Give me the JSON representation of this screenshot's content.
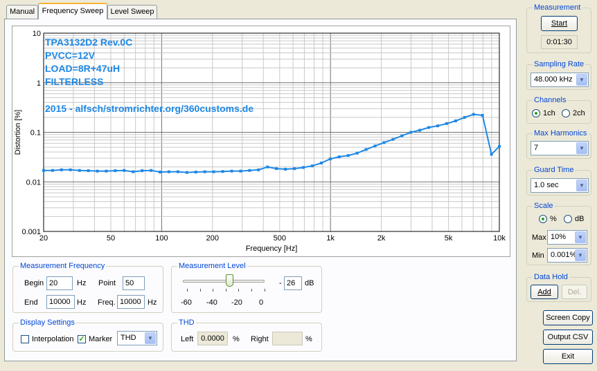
{
  "tabs": [
    {
      "label": "Manual"
    },
    {
      "label": "Frequency Sweep"
    },
    {
      "label": "Level Sweep"
    }
  ],
  "chart_data": {
    "type": "line",
    "ylabel": "Distortion [%]",
    "xlabel": "Frequency [Hz]",
    "x_scale": "log",
    "y_scale": "log",
    "xlim": [
      20,
      10000
    ],
    "ylim": [
      0.001,
      10
    ],
    "x_ticks": [
      "20",
      "50",
      "100",
      "200",
      "500",
      "1k",
      "2k",
      "5k",
      "10k"
    ],
    "y_ticks": [
      "10",
      "1",
      "0.1",
      "0.01",
      "0.001"
    ],
    "annotations": [
      "TPA3132D2 Rev.0C",
      "PVCC=12V",
      "LOAD=8R+47uH",
      "FILTERLESS",
      "2015 - alfsch/stromrichter.org/360customs.de"
    ],
    "line_color": "#1e88e5",
    "grid": true,
    "series": [
      {
        "x": [
          20,
          22.6,
          25.5,
          28.8,
          32.6,
          36.8,
          41.6,
          47,
          53.1,
          60,
          67.8,
          76.6,
          86.6,
          97.8,
          110.5,
          124.9,
          141.1,
          159.4,
          180.1,
          203.5,
          230,
          259.9,
          293.6,
          331.8,
          374.9,
          423.6,
          478.7,
          540.9,
          611.2,
          690.6,
          780.3,
          881.7,
          996.3,
          1125.8,
          1272,
          1437.3,
          1624.1,
          1835.1,
          2073.5,
          2342.9,
          2647.3,
          2991.3,
          3379.9,
          3819.1,
          4315.3,
          4876,
          5509.5,
          6225.4,
          7034.3,
          7948.2,
          8981,
          10000
        ],
        "y": [
          0.017,
          0.017,
          0.0175,
          0.0175,
          0.017,
          0.0168,
          0.0165,
          0.0165,
          0.0168,
          0.017,
          0.016,
          0.0168,
          0.017,
          0.0158,
          0.016,
          0.016,
          0.0155,
          0.0158,
          0.016,
          0.016,
          0.0162,
          0.0165,
          0.0165,
          0.017,
          0.0175,
          0.02,
          0.0185,
          0.018,
          0.0185,
          0.0195,
          0.021,
          0.024,
          0.029,
          0.032,
          0.034,
          0.038,
          0.045,
          0.053,
          0.062,
          0.072,
          0.085,
          0.1,
          0.11,
          0.125,
          0.135,
          0.15,
          0.17,
          0.2,
          0.23,
          0.22,
          0.036,
          0.052
        ]
      }
    ]
  },
  "meas_freq": {
    "title": "Measurement Frequency",
    "begin_label": "Begin",
    "begin_value": "20",
    "begin_unit": "Hz",
    "end_label": "End",
    "end_value": "10000",
    "end_unit": "Hz",
    "point_label": "Point",
    "point_value": "50",
    "freq_label": "Freq.",
    "freq_value": "10000",
    "freq_unit": "Hz"
  },
  "meas_level": {
    "title": "Measurement Level",
    "value": "26",
    "prefix": "-",
    "unit": "dB",
    "ticks": [
      "-60",
      "-40",
      "-20",
      "0"
    ],
    "slider_fraction": 0.57
  },
  "display": {
    "title": "Display Settings",
    "interpolation_label": "Interpolation",
    "interpolation_checked": false,
    "marker_label": "Marker",
    "marker_checked": true,
    "mode": "THD"
  },
  "thd": {
    "title": "THD",
    "left_label": "Left",
    "left_value": "0.0000",
    "left_unit": "%",
    "right_label": "Right",
    "right_value": "",
    "right_unit": "%"
  },
  "measurement": {
    "title": "Measurement",
    "start_label": "Start",
    "timer": "0:01:30"
  },
  "sampling": {
    "title": "Sampling Rate",
    "value": "48.000 kHz"
  },
  "channels": {
    "title": "Channels",
    "opt1": "1ch",
    "opt2": "2ch",
    "selected": "1ch"
  },
  "harmonics": {
    "title": "Max Harmonics",
    "value": "7"
  },
  "guard": {
    "title": "Guard Time",
    "value": "1.0 sec"
  },
  "scale": {
    "title": "Scale",
    "opt_pct": "%",
    "opt_db": "dB",
    "selected": "%",
    "max_label": "Max",
    "max_value": "10%",
    "min_label": "Min",
    "min_value": "0.001%"
  },
  "data_hold": {
    "title": "Data Hold",
    "add_label": "Add",
    "del_label": "Del."
  },
  "buttons": {
    "screen_copy": "Screen Copy",
    "output_csv": "Output CSV",
    "exit": "Exit"
  }
}
